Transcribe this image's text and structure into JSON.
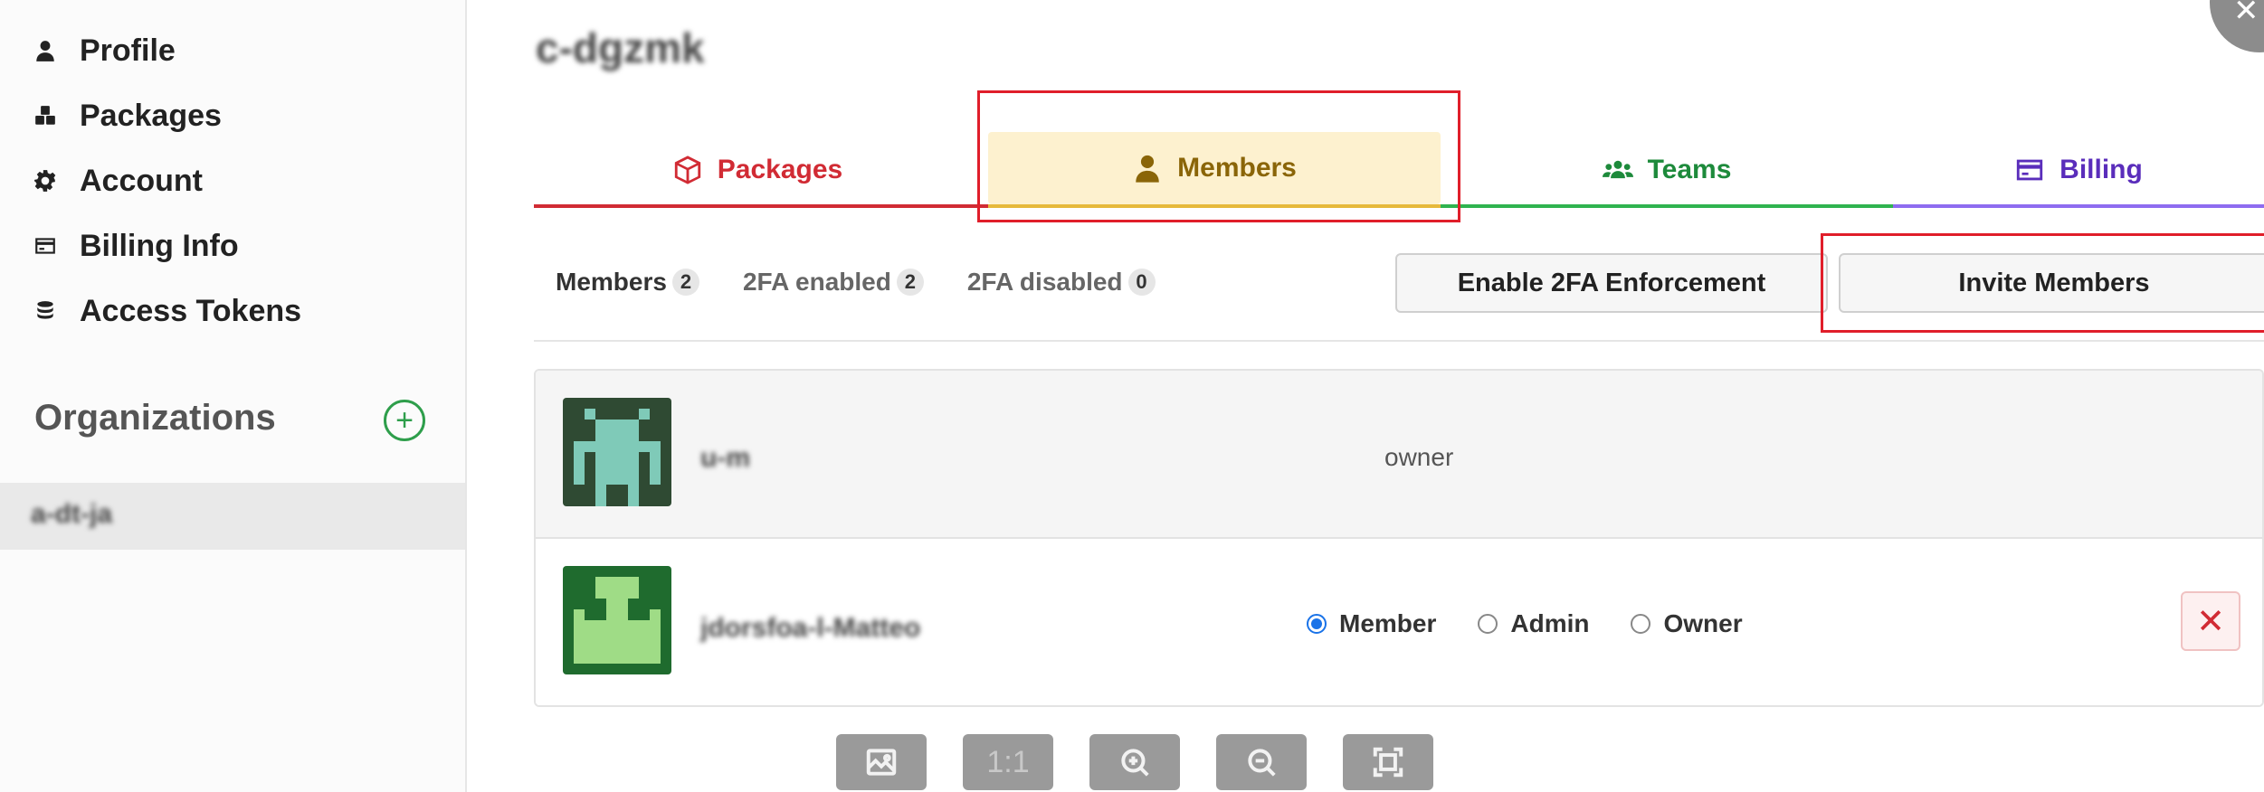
{
  "sidebar": {
    "items": [
      {
        "label": "Profile",
        "icon": "user-icon"
      },
      {
        "label": "Packages",
        "icon": "packages-icon"
      },
      {
        "label": "Account",
        "icon": "gear-icon"
      },
      {
        "label": "Billing Info",
        "icon": "credit-card-icon"
      },
      {
        "label": "Access Tokens",
        "icon": "coins-icon"
      }
    ],
    "organizations_title": "Organizations",
    "add_org_symbol": "+",
    "org_entry": "a-dt-ja"
  },
  "main": {
    "org_name": "c-dgzmk",
    "tabs": [
      {
        "label": "Packages",
        "color": "#d12b34",
        "icon": "box-icon"
      },
      {
        "label": "Members",
        "color": "#8a6508",
        "icon": "user-icon",
        "active": true
      },
      {
        "label": "Teams",
        "color": "#1d8a3b",
        "icon": "users-icon"
      },
      {
        "label": "Billing",
        "color": "#5a2dbb",
        "icon": "credit-card-icon"
      }
    ],
    "filters": [
      {
        "label": "Members",
        "count": "2"
      },
      {
        "label": "2FA enabled",
        "count": "2"
      },
      {
        "label": "2FA disabled",
        "count": "0"
      }
    ],
    "enable_2fa_button": "Enable 2FA Enforcement",
    "invite_button": "Invite Members",
    "members": [
      {
        "name": "u-m",
        "role": "owner"
      },
      {
        "name": "jdorsfoa-l-Matteo",
        "roles": [
          "Member",
          "Admin",
          "Owner"
        ],
        "selected_role": "Member",
        "remove_symbol": "✕"
      }
    ]
  },
  "viewer_toolbar": {
    "actual_size_label": "1:1",
    "close_symbol": "✕"
  },
  "colors": {
    "highlight": "#e01e2a",
    "members_tab_bg": "#fdf1cf"
  }
}
